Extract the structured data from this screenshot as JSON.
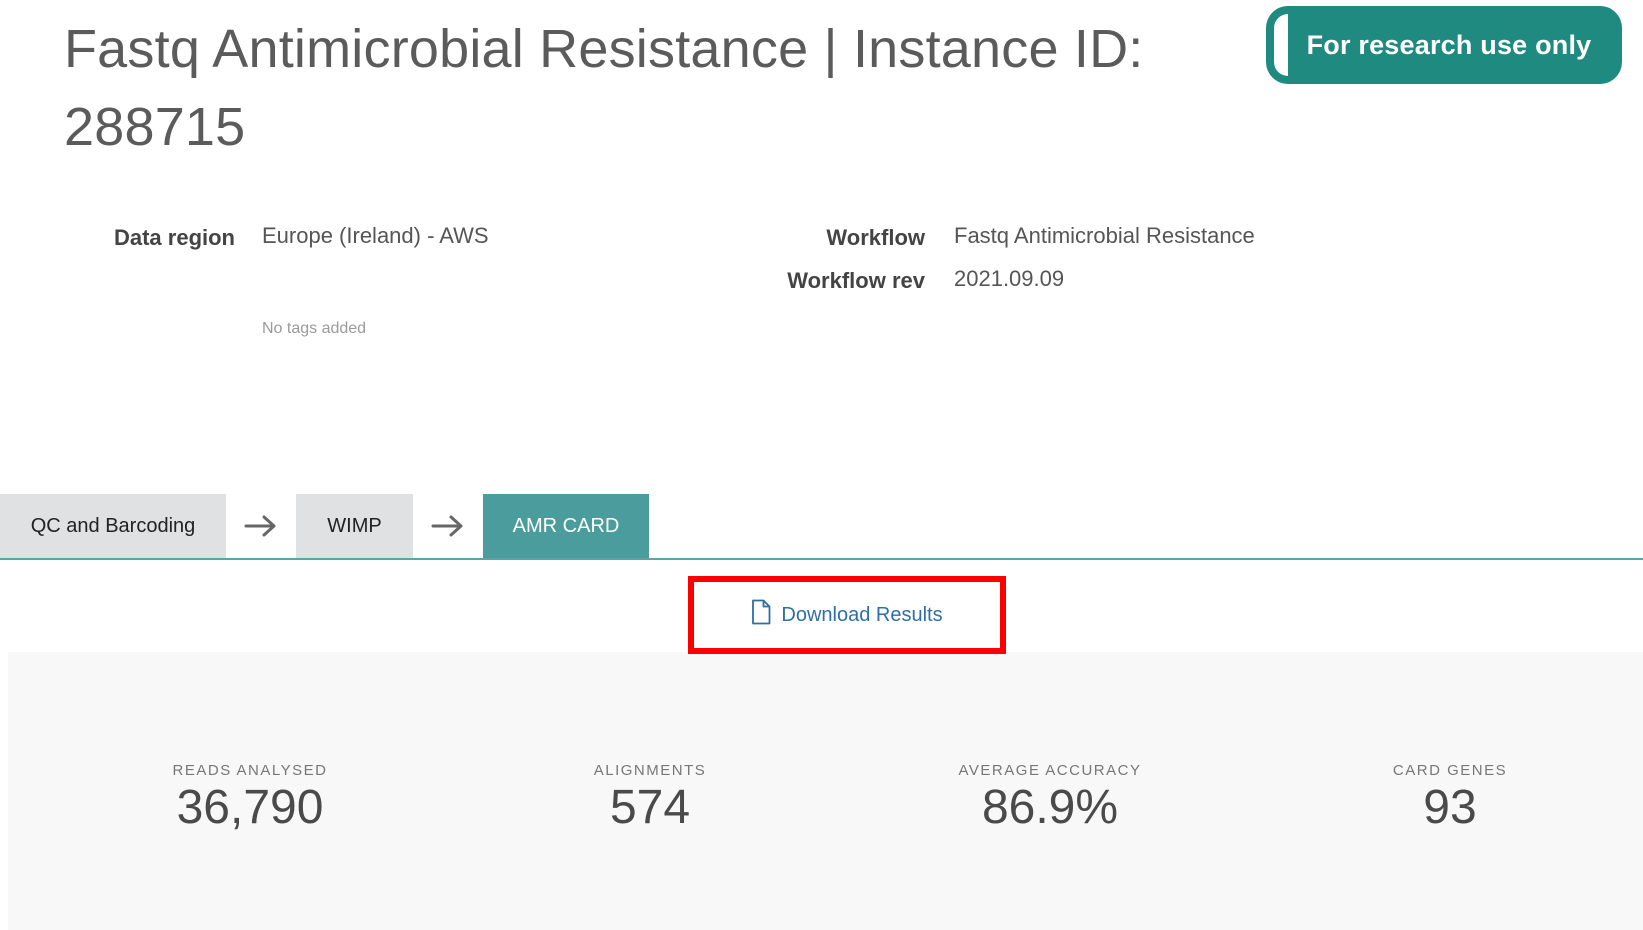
{
  "header": {
    "title": "Fastq Antimicrobial Resistance | Instance ID: 288715",
    "badge": "For research use only"
  },
  "meta": {
    "data_region_label": "Data region",
    "data_region_value": "Europe (Ireland) - AWS",
    "tags_note": "No tags added",
    "workflow_label": "Workflow",
    "workflow_value": "Fastq Antimicrobial Resistance",
    "workflow_rev_label": "Workflow rev",
    "workflow_rev_value": "2021.09.09"
  },
  "steps": [
    {
      "label": "QC and Barcoding",
      "active": false
    },
    {
      "label": "WIMP",
      "active": false
    },
    {
      "label": "AMR CARD",
      "active": true
    }
  ],
  "download": {
    "label": "Download Results",
    "icon": "file-icon"
  },
  "stats": [
    {
      "label": "READS ANALYSED",
      "value": "36,790"
    },
    {
      "label": "ALIGNMENTS",
      "value": "574"
    },
    {
      "label": "AVERAGE ACCURACY",
      "value": "86.9%"
    },
    {
      "label": "CARD GENES",
      "value": "93"
    }
  ],
  "colors": {
    "badge": "#1e8a80",
    "active_step": "#4a9d9c",
    "inactive_step": "#dfe1e2",
    "highlight_border": "#ff0000",
    "link": "#2f6fa5"
  }
}
